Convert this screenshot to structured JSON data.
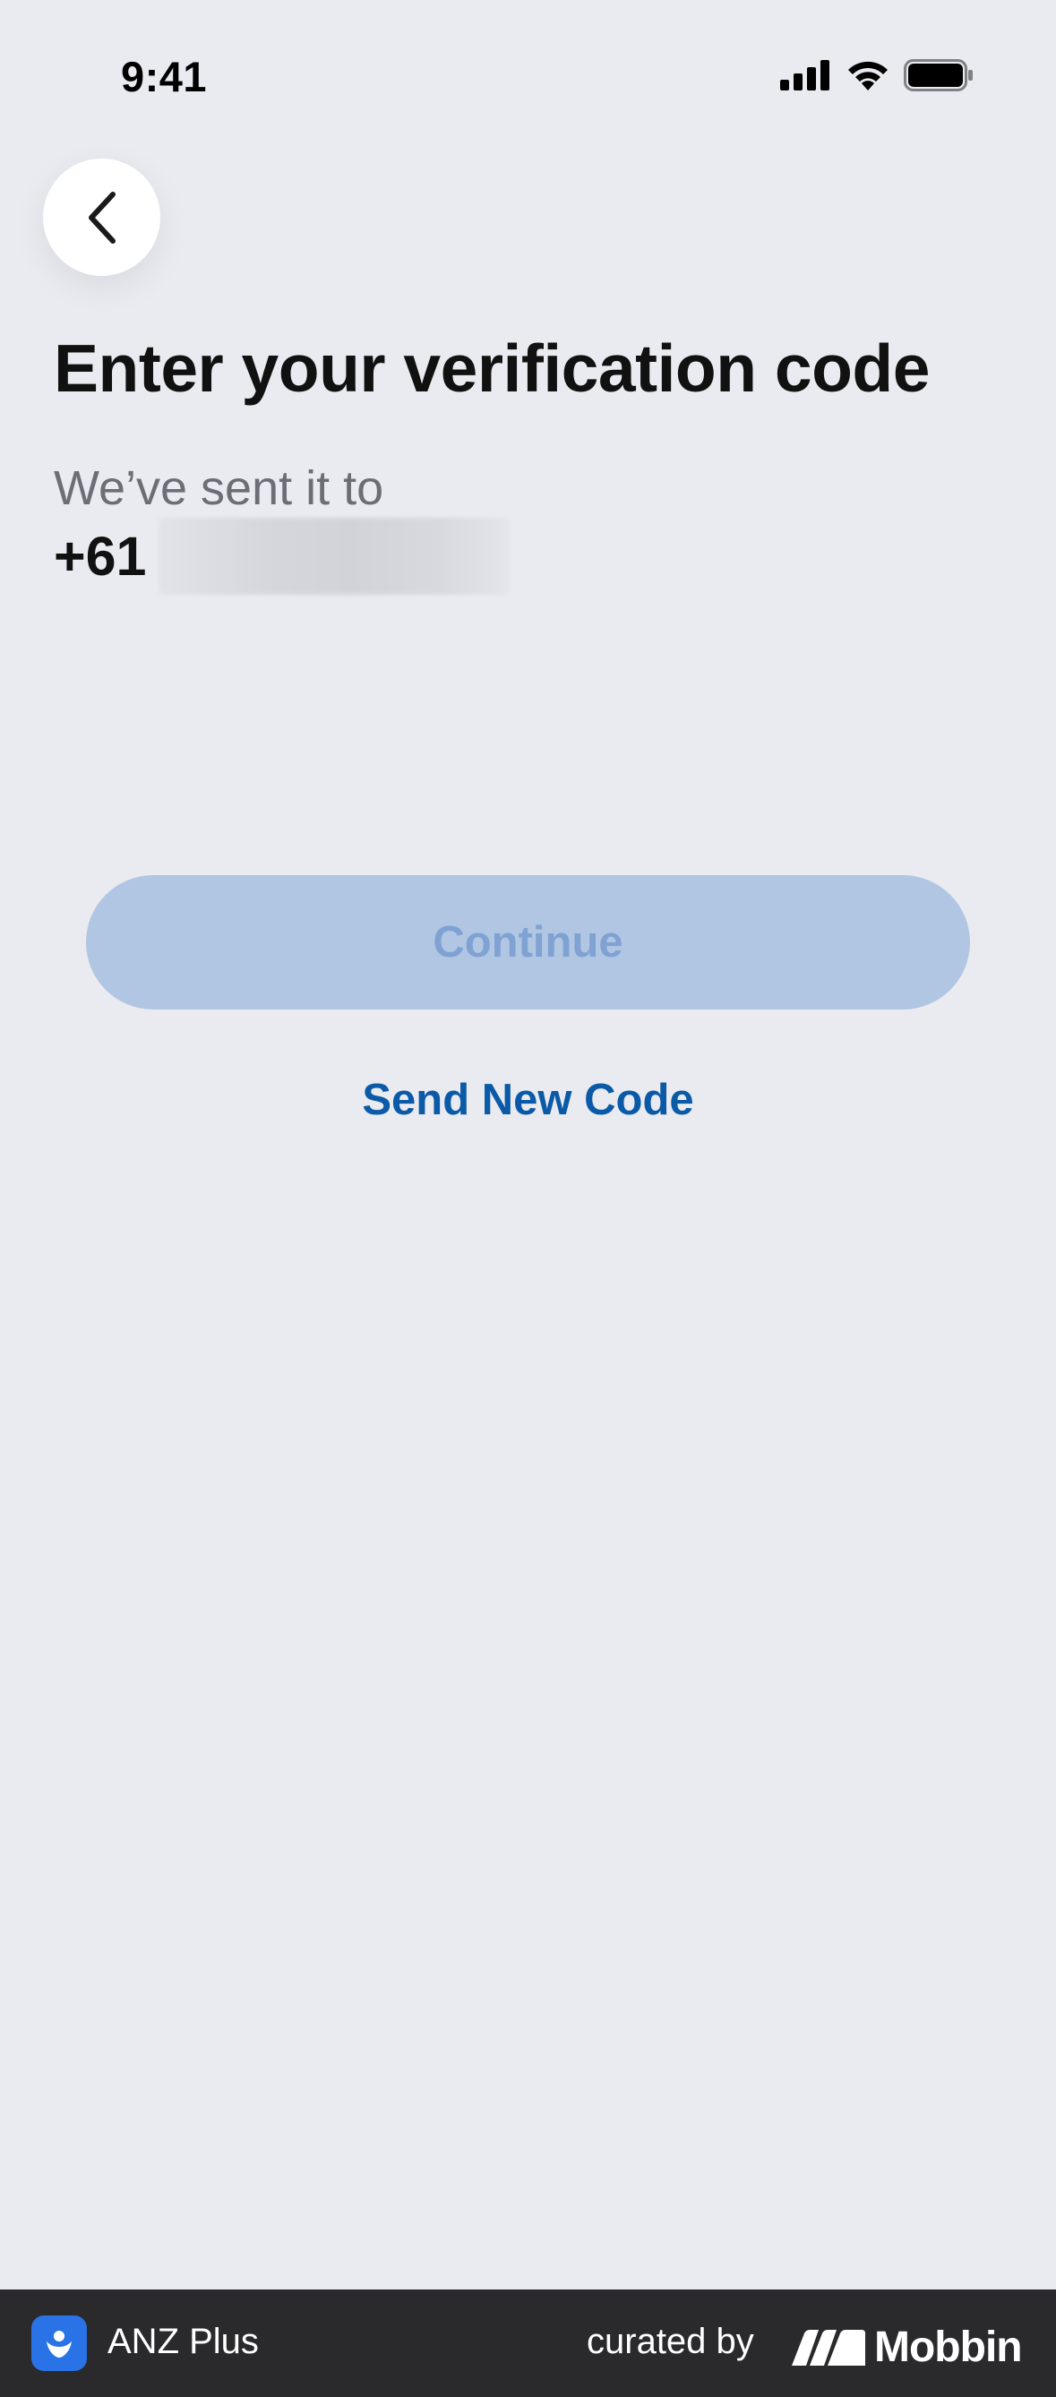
{
  "status_bar": {
    "time": "9:41",
    "icons": [
      "signal-icon",
      "wifi-icon",
      "battery-icon"
    ]
  },
  "header": {
    "back_icon": "chevron-left-icon"
  },
  "main": {
    "title": "Enter your verification code",
    "sent_label": "We’ve sent it to",
    "phone_prefix": "+61",
    "continue_label": "Continue",
    "send_new_code_label": "Send New Code"
  },
  "footer": {
    "app_name": "ANZ Plus",
    "curated_by": "curated by",
    "brand": "Mobbin"
  },
  "colors": {
    "background": "#EAEBF0",
    "continue_disabled_bg": "#B0C6E2",
    "continue_disabled_text": "#7FA2D3",
    "link_blue": "#0B5AA8",
    "footer_bg": "#2A2A2C",
    "app_icon_bg": "#2A73E6"
  }
}
